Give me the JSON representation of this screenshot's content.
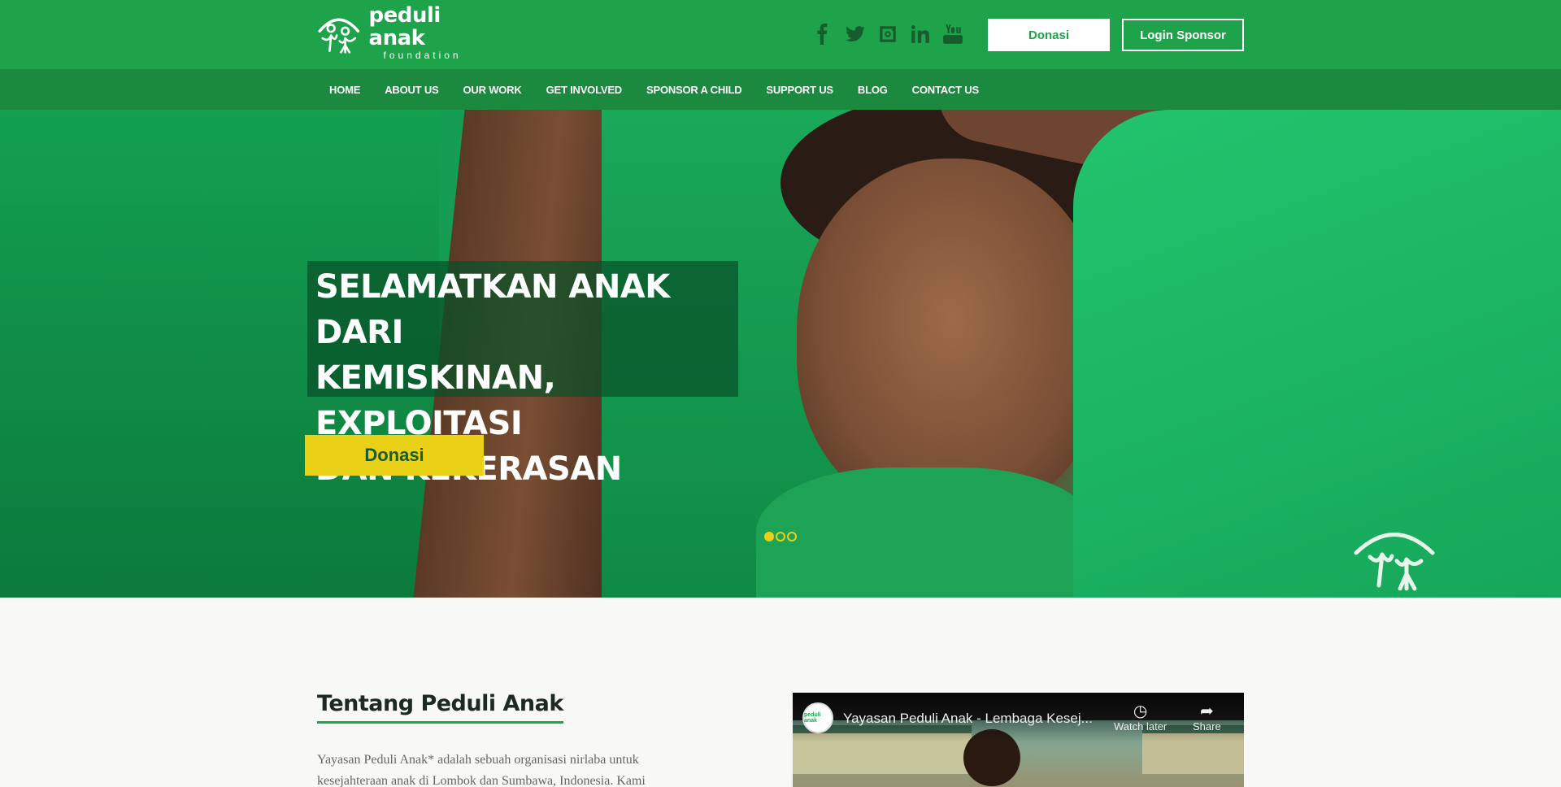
{
  "brand": {
    "name": "peduli anak",
    "sub": "foundation",
    "color_primary": "#1ea34a",
    "color_nav": "#1b8a3f",
    "color_accent": "#e8d117"
  },
  "header": {
    "socials": [
      "facebook-icon",
      "twitter-icon",
      "instagram-icon",
      "linkedin-icon",
      "youtube-icon"
    ],
    "donasi_label": "Donasi",
    "login_label": "Login Sponsor"
  },
  "nav": {
    "items": [
      "HOME",
      "ABOUT US",
      "OUR WORK",
      "GET INVOLVED",
      "SPONSOR A CHILD",
      "SUPPORT US",
      "BLOG",
      "CONTACT US"
    ]
  },
  "hero": {
    "title_lines": [
      "SELAMATKAN ANAK DARI",
      "KEMISKINAN, EXPLOITASI",
      "DAN KEKERASAN"
    ],
    "button_label": "Donasi",
    "slides_total": 3,
    "slide_active": 1
  },
  "about": {
    "title": "Tentang Peduli Anak",
    "text": "Yayasan Peduli Anak* adalah sebuah organisasi nirlaba untuk kesejahteraan anak di Lombok dan Sumbawa, Indonesia. Kami"
  },
  "video": {
    "title": "Yayasan Peduli Anak - Lembaga Kesej...",
    "watch_later": "Watch later",
    "share": "Share"
  }
}
